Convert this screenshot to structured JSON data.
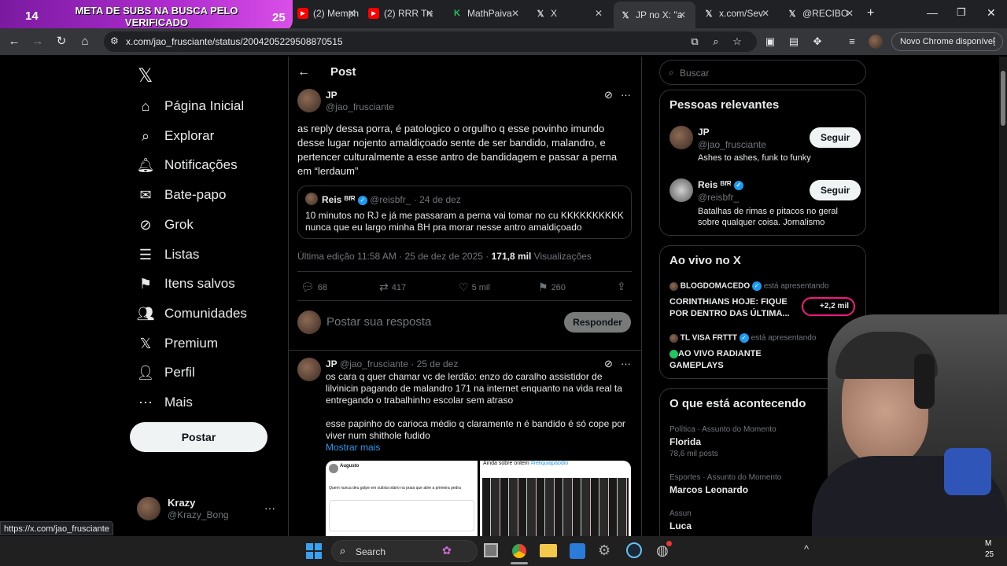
{
  "stream_banner": {
    "left_number": "14",
    "message": "META DE SUBS NA BUSCA PELO VERIFICADO",
    "right_number": "25"
  },
  "tabs": [
    {
      "label": "(2) Memph",
      "icon": "youtube-icon"
    },
    {
      "label": "(2) RRR Tra",
      "icon": "youtube-icon"
    },
    {
      "label": "MathPaiva",
      "icon": "kiwify-icon"
    },
    {
      "label": "X",
      "icon": "x-icon"
    },
    {
      "label": "JP no X: \"a",
      "icon": "x-icon"
    },
    {
      "label": "x.com/Sev",
      "icon": "x-icon"
    },
    {
      "label": "@RECIBO",
      "icon": "x-icon"
    }
  ],
  "addressbar": {
    "url": "x.com/jao_frusciante/status/2004205229508870515",
    "new_chrome": "Novo Chrome disponível"
  },
  "nav": {
    "items": [
      {
        "label": "Página Inicial",
        "icon": "home-icon"
      },
      {
        "label": "Explorar",
        "icon": "search-icon"
      },
      {
        "label": "Notificações",
        "icon": "bell-icon"
      },
      {
        "label": "Bate-papo",
        "icon": "mail-icon"
      },
      {
        "label": "Grok",
        "icon": "grok-icon"
      },
      {
        "label": "Listas",
        "icon": "list-icon"
      },
      {
        "label": "Itens salvos",
        "icon": "bookmark-icon"
      },
      {
        "label": "Comunidades",
        "icon": "people-icon"
      },
      {
        "label": "Premium",
        "icon": "x-icon"
      },
      {
        "label": "Perfil",
        "icon": "person-icon"
      },
      {
        "label": "Mais",
        "icon": "more-circle-icon"
      }
    ],
    "post_button": "Postar",
    "account": {
      "name": "Krazy",
      "handle": "@Krazy_Bong"
    }
  },
  "post": {
    "header": "Post",
    "author": {
      "name": "JP",
      "handle": "@jao_frusciante"
    },
    "text": "as reply dessa porra, é patologico o orgulho q esse povinho imundo desse lugar nojento amaldiçoado sente de ser bandido, malandro, e pertencer culturalmente a esse antro de bandidagem e passar a perna em “lerdaum”",
    "quote": {
      "name": "Reis ᴮᶠᴿ",
      "handle": "@reisbfr_",
      "date": "· 24 de dez",
      "text": "10 minutos no RJ e já me passaram a perna vai tomar no cu KKKKKKKKKK nunca que eu largo minha BH pra morar nesse antro amaldiçoado"
    },
    "meta": {
      "edited": "Última edição 11:58 AM · 25 de dez de 2025 ·",
      "views": "171,8 mil",
      "views_label": "Visualizações"
    },
    "stats": {
      "replies": "68",
      "reposts": "417",
      "likes": "5 mil",
      "bookmarks": "260"
    },
    "reply_placeholder": "Postar sua resposta",
    "reply_button": "Responder"
  },
  "reply": {
    "name": "JP",
    "handle": "@jao_frusciante",
    "date": "· 25 de dez",
    "text1": "os cara q quer chamar vc de lerdão: enzo do caralho assistidor de lilvinicin pagando de malandro 171 na internet enquanto na vida real ta entregando o trabalhinho escolar sem atraso",
    "text2": "esse papinho do carioca médio q claramente n é bandido é só cope por viver num shithole fudido",
    "show_more": "Mostrar mais",
    "img1_author": "Augusto",
    "img1_line": "Quem nunca deu golpe em sulista otário na praia que atire a primeira pedra",
    "img2_caption_prefix": "Ainda sobre ontem",
    "img2_caption_tag": "#reliquiapaodio"
  },
  "right": {
    "search_placeholder": "Buscar",
    "relevant": {
      "title": "Pessoas relevantes",
      "people": [
        {
          "name": "JP",
          "handle": "@jao_frusciante",
          "bio": "Ashes to ashes, funk to funky",
          "button": "Seguir"
        },
        {
          "name": "Reis ᴮᶠᴿ",
          "handle": "@reisbfr_",
          "bio": "Batalhas de rimas e pitacos no geral sobre qualquer coisa. Jornalismo",
          "button": "Seguir"
        }
      ]
    },
    "live": {
      "title": "Ao vivo no X",
      "items": [
        {
          "host": "BLOGDOMACEDO",
          "status": "está apresentando",
          "title": "CORINTHIANS HOJE: FIQUE POR DENTRO DAS ÚLTIMA...",
          "count": "+2,2 mil"
        },
        {
          "host": "TL VISA FRTTT",
          "status": "está apresentando",
          "title": "AO VIVO RADIANTE GAMEPLAYS"
        }
      ]
    },
    "trends": {
      "title": "O que está acontecendo",
      "items": [
        {
          "category": "Política · Assunto do Momento",
          "name": "Florida",
          "posts": "78,6 mil posts"
        },
        {
          "category": "Esportes · Assunto do Momento",
          "name": "Marcos Leonardo",
          "posts": ""
        },
        {
          "category": "Assun",
          "name": "Luca",
          "posts": ""
        }
      ]
    }
  },
  "status_url": "https://x.com/jao_frusciante",
  "taskbar": {
    "search": "Search",
    "clock_line1": "M",
    "clock_line2": "25"
  },
  "colors": {
    "accent": "#1d9bf0",
    "background": "#000000",
    "banner": "#b02cd0"
  }
}
